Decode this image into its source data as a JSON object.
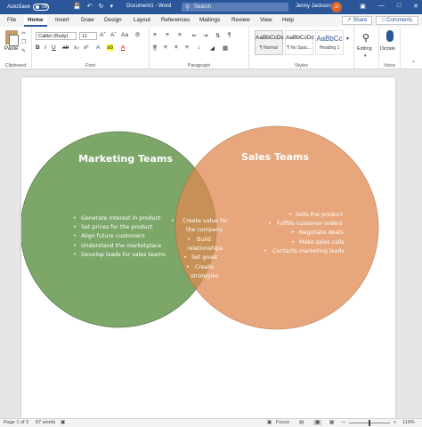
{
  "titlebar": {
    "autosave_label": "AutoSave",
    "autosave_state": "Off",
    "doc_title": "Document1 - Word",
    "search_placeholder": "Search",
    "user_name": "Jenny Jackson",
    "user_initials": "JJ"
  },
  "tabs": [
    "File",
    "Home",
    "Insert",
    "Draw",
    "Design",
    "Layout",
    "References",
    "Mailings",
    "Review",
    "View",
    "Help"
  ],
  "active_tab": "Home",
  "share_label": "Share",
  "comments_label": "Comments",
  "ribbon": {
    "clipboard": {
      "paste_label": "Paste",
      "group_label": "Clipboard"
    },
    "font": {
      "font_name": "Calibri (Body)",
      "font_size": "11",
      "group_label": "Font"
    },
    "paragraph": {
      "group_label": "Paragraph"
    },
    "styles": {
      "group_label": "Styles",
      "items": [
        {
          "sample": "AaBbCcDc",
          "name": "¶ Normal"
        },
        {
          "sample": "AaBbCcDc",
          "name": "¶ No Spac..."
        },
        {
          "sample": "AaBbCc",
          "name": "Heading 1"
        }
      ]
    },
    "editing_label": "Editing",
    "voice": {
      "dictate_label": "Dictate",
      "group_label": "Voice"
    }
  },
  "venn": {
    "left": {
      "title": "Marketing Teams",
      "items": [
        "Generate interest in product",
        "Set prices for the product",
        "Align future customers",
        "Understand the marketplace",
        "Develop leads for sales teams"
      ],
      "color": "#7da669"
    },
    "overlap": {
      "items": [
        "Create value for",
        "the company",
        "Build",
        "relationships",
        "Set goals",
        "Create",
        "strategies"
      ]
    },
    "right": {
      "title": "Sales Teams",
      "items": [
        "Sells the product",
        "Fulfills customer orders",
        "Negotiate deals",
        "Make sales calls",
        "Contacts marketing leads"
      ],
      "color": "#e08950"
    }
  },
  "statusbar": {
    "page": "Page 1 of 2",
    "words": "87 words",
    "focus": "Focus",
    "zoom": "110%"
  }
}
